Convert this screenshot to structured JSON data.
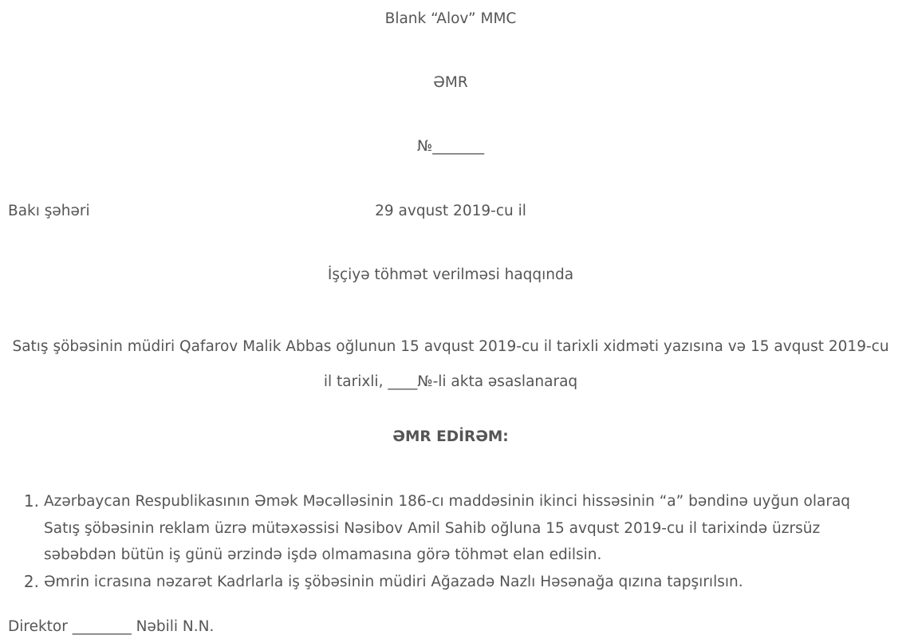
{
  "header": {
    "company": "Blank “Alov” MMC",
    "order_title": "ƏMR",
    "order_number": "№_______"
  },
  "place_date": {
    "city": "Bakı şəhəri",
    "date": "29 avqust 2019-cu il"
  },
  "subject": "İşçiyə töhmət verilməsi haqqında",
  "basis": "Satış şöbəsinin müdiri Qafarov Malik Abbas oğlunun 15 avqust 2019-cu il tarixli xidməti yazısına və 15 avqust 2019-cu il tarixli, ____№-li akta əsaslanaraq",
  "command": "ƏMR EDİRƏM:",
  "items": [
    {
      "number": "1.",
      "text": "Azərbaycan Respublikasının Əmək Məcəlləsinin 186-cı maddəsinin ikinci hissəsinin “a” bəndinə uyğun olaraq Satış şöbəsinin reklam üzrə mütəxəssisi Nəsibov Amil Sahib oğluna 15 avqust 2019-cu il tarixində üzrsüz səbəbdən bütün iş günü ərzində işdə olmamasına görə töhmət elan edilsin."
    },
    {
      "number": "2.",
      "text": "Əmrin icrasına nəzarət Kadrlarla iş şöbəsinin müdiri Ağazadə Nazlı Həsənağa qızına tapşırılsın."
    }
  ],
  "signature": "Direktor ________ Nəbili N.N."
}
